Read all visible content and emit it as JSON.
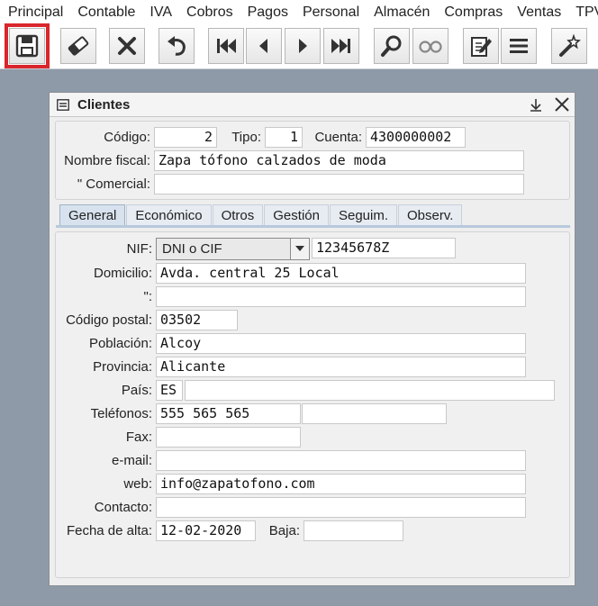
{
  "menubar": [
    "Principal",
    "Contable",
    "IVA",
    "Cobros",
    "Pagos",
    "Personal",
    "Almacén",
    "Compras",
    "Ventas",
    "TPV"
  ],
  "toolbar": {
    "icons": [
      "save-icon",
      "eraser-icon",
      "close-icon",
      "undo-icon",
      "first-record-icon",
      "previous-record-icon",
      "next-record-icon",
      "last-record-icon",
      "search-icon",
      "glasses-icon",
      "edit-document-icon",
      "menu-icon",
      "wand-icon"
    ],
    "highlight_color": "#d9262c"
  },
  "window": {
    "title": "Clientes",
    "header": {
      "codigo_label": "Código:",
      "codigo_value": "2",
      "tipo_label": "Tipo:",
      "tipo_value": "1",
      "cuenta_label": "Cuenta:",
      "cuenta_value": "4300000002",
      "nombre_fiscal_label": "Nombre fiscal:",
      "nombre_fiscal_value": "Zapa tófono calzados de moda",
      "comercial_label": "\" Comercial:",
      "comercial_value": ""
    },
    "tabs": [
      "General",
      "Económico",
      "Otros",
      "Gestión",
      "Seguim.",
      "Observ."
    ],
    "general": {
      "nif_label": "NIF:",
      "nif_type": "DNI o CIF",
      "nif_value": "12345678Z",
      "domicilio_label": "Domicilio:",
      "domicilio_value": "Avda. central 25 Local",
      "domicilio2_label": "\":",
      "domicilio2_value": "",
      "codigo_postal_label": "Código postal:",
      "codigo_postal_value": "03502",
      "poblacion_label": "Población:",
      "poblacion_value": "Alcoy",
      "provincia_label": "Provincia:",
      "provincia_value": "Alicante",
      "pais_label": "País:",
      "pais_code": "ES",
      "pais_name": "",
      "telefonos_label": "Teléfonos:",
      "telefono1": "555 565 565",
      "telefono2": "",
      "fax_label": "Fax:",
      "fax_value": "",
      "email_label": "e-mail:",
      "email_value": "",
      "web_label": "web:",
      "web_value": "info@zapatofono.com",
      "contacto_label": "Contacto:",
      "contacto_value": "",
      "fecha_alta_label": "Fecha de alta:",
      "fecha_alta_value": "12-02-2020",
      "baja_label": "Baja:",
      "baja_value": ""
    }
  }
}
